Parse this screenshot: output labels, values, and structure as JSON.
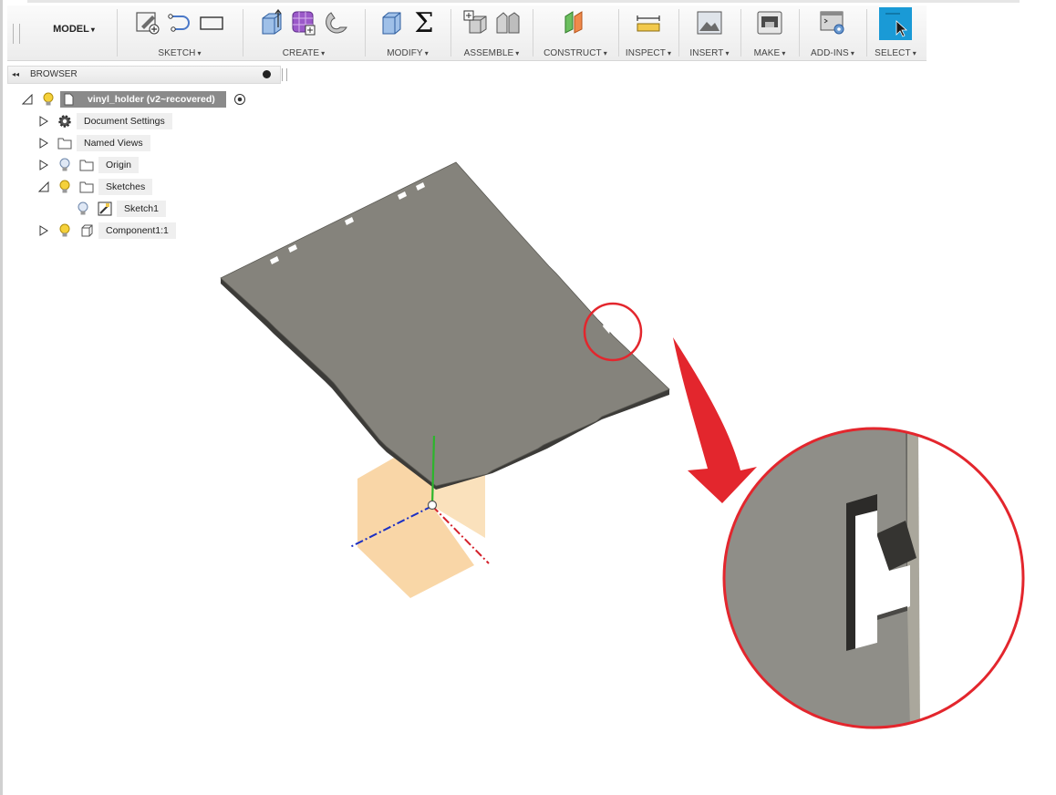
{
  "toolbar": {
    "workspace": "MODEL",
    "groups": [
      {
        "id": "sketch",
        "label": "SKETCH"
      },
      {
        "id": "create",
        "label": "CREATE"
      },
      {
        "id": "modify",
        "label": "MODIFY"
      },
      {
        "id": "assemble",
        "label": "ASSEMBLE"
      },
      {
        "id": "construct",
        "label": "CONSTRUCT"
      },
      {
        "id": "inspect",
        "label": "INSPECT"
      },
      {
        "id": "insert",
        "label": "INSERT"
      },
      {
        "id": "make",
        "label": "MAKE"
      },
      {
        "id": "addins",
        "label": "ADD-INS"
      },
      {
        "id": "select",
        "label": "SELECT"
      }
    ],
    "caret": "▾"
  },
  "browser": {
    "title": "BROWSER",
    "collapse_glyph": "◂◂",
    "root": "vinyl_holder (v2~recovered)",
    "items": [
      {
        "label": "Document Settings"
      },
      {
        "label": "Named Views"
      },
      {
        "label": "Origin"
      },
      {
        "label": "Sketches"
      },
      {
        "label": "Sketch1"
      },
      {
        "label": "Component1:1"
      }
    ]
  },
  "colors": {
    "plate": "#85837c",
    "plate_edge": "#3c3b38",
    "callout": "#e3262d",
    "active_select": "#1a9ad6",
    "origin_plane": "#f7c98a"
  }
}
